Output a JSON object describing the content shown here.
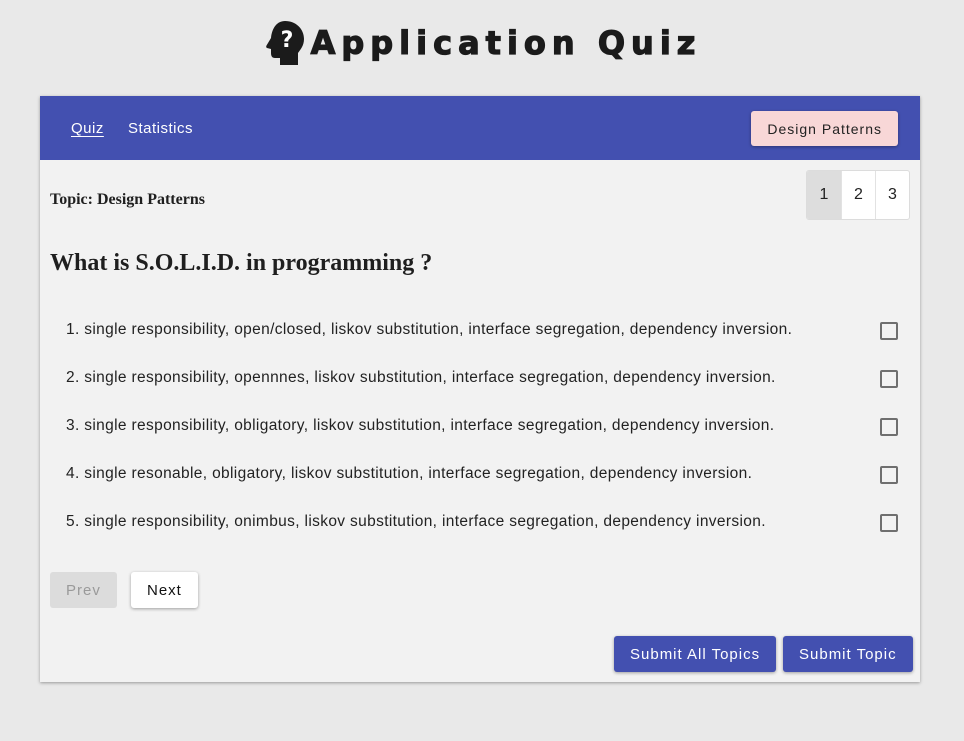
{
  "app": {
    "title": "Application Quiz"
  },
  "nav": {
    "links": [
      {
        "label": "Quiz"
      },
      {
        "label": "Statistics"
      }
    ],
    "topic_button": "Design Patterns"
  },
  "topic": {
    "label": "Topic: Design Patterns"
  },
  "pager": {
    "pages": [
      "1",
      "2",
      "3"
    ],
    "current": "1"
  },
  "question": {
    "text": "What is S.O.L.I.D. in programming ?",
    "answers": [
      {
        "text": "1. single responsibility, open/closed, liskov substitution, interface segregation, dependency inversion.",
        "checked": false
      },
      {
        "text": "2. single responsibility, opennnes, liskov substitution, interface segregation, dependency inversion.",
        "checked": false
      },
      {
        "text": "3. single responsibility, obligatory, liskov substitution, interface segregation, dependency inversion.",
        "checked": false
      },
      {
        "text": "4. single resonable, obligatory, liskov substitution, interface segregation, dependency inversion.",
        "checked": false
      },
      {
        "text": "5. single responsibility, onimbus, liskov substitution, interface segregation, dependency inversion.",
        "checked": false
      }
    ]
  },
  "controls": {
    "prev": "Prev",
    "next": "Next",
    "submit_all": "Submit All Topics",
    "submit_topic": "Submit Topic"
  },
  "colors": {
    "primary": "#4350b0",
    "topic_button_bg": "#f8d7d7",
    "page_bg": "#e9e9e9",
    "card_bg": "#f2f2f2"
  },
  "icons": {
    "logo": "head-question-mark-icon"
  }
}
